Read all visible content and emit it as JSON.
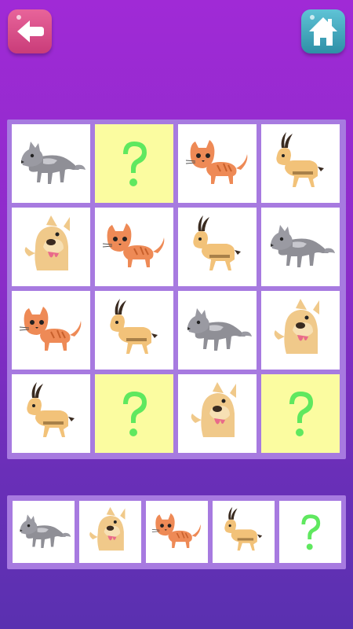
{
  "buttons": {
    "back": {
      "icon": "back-arrow-icon",
      "color": "#d84d88"
    },
    "home": {
      "icon": "home-icon",
      "color": "#44a9be"
    }
  },
  "puzzle": {
    "type": "animal sudoku 4x4",
    "grid": [
      [
        "wolf",
        "unknown",
        "cat",
        "antelope"
      ],
      [
        "dog",
        "cat",
        "antelope",
        "wolf"
      ],
      [
        "cat",
        "antelope",
        "wolf",
        "dog"
      ],
      [
        "antelope",
        "unknown",
        "dog",
        "unknown"
      ]
    ],
    "unknown_cell_color": "#fbfca0",
    "unknown_symbol": "?",
    "question_color": "#5fe85f"
  },
  "choices": [
    "wolf",
    "dog",
    "cat",
    "antelope",
    "unknown"
  ],
  "colors": {
    "board_bg": "#a77ae0",
    "page_bg_top": "#a02ad6",
    "page_bg_bottom": "#5a30b0"
  }
}
